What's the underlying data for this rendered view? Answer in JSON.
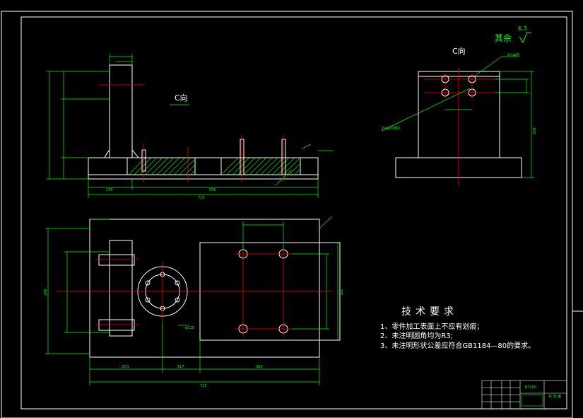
{
  "views": {
    "front_view_label": "C向",
    "side_view_label": "C向"
  },
  "surface_finish": {
    "label": "其余",
    "value": "6.3"
  },
  "dimensions": {
    "front_overall_width": "725",
    "front_left_segment": "135",
    "front_mid_segment": "506",
    "plan_overall_width": "725",
    "plan_left_segment": "25.5",
    "plan_mid_segment": "117",
    "plan_right_segment": "300",
    "plan_height_left": "288",
    "plan_height_right": "301",
    "side_height": "218",
    "side_hole_callout": "2×φ20",
    "side_hole_callout_2": "2×φ20通孔",
    "bolt_circle": "φ110"
  },
  "technical_requirements": {
    "title": "技术要求",
    "items": [
      "1、零件加工表面上不应有划痕；",
      "2、未注明圆角均为R3;",
      "3、未注明形状公差应符合GB1184—80的要求。"
    ]
  },
  "title_block": {
    "drawing_code": "BT200",
    "sheet_info": "共 张 第"
  },
  "colors": {
    "background": "#000000",
    "outline": "#ffffff",
    "dimension": "#00ff00",
    "centerline": "#ff0000",
    "hatch": "#00ff00",
    "text": "#ffffff"
  }
}
